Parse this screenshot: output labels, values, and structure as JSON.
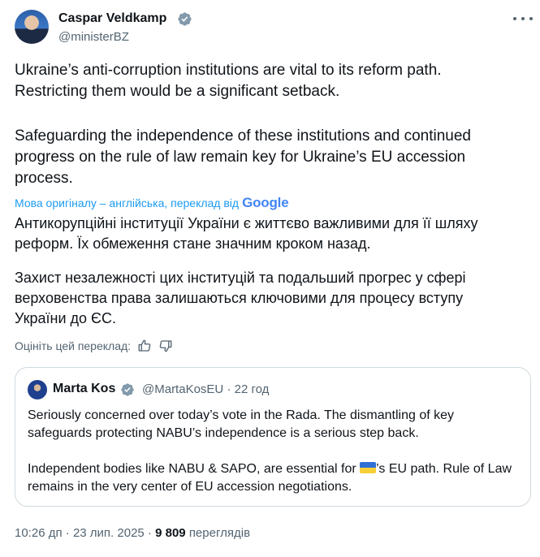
{
  "tweet": {
    "author_name": "Caspar Veldkamp",
    "handle": "@ministerBZ",
    "paragraph1": "Ukraine’s anti-corruption institutions are vital to its reform path.\nRestricting them would be a significant setback.",
    "paragraph2": "Safeguarding the independence of these institutions and continued\nprogress on the rule of law remain key for Ukraine’s EU accession\nprocess.",
    "translation_note": "Мова оригіналу – англійська, переклад від",
    "translation_provider": "Google",
    "translated_paragraph1": "Антикорупційні інституції України є життєво важливими для її шляху\nреформ. Їх обмеження стане значним кроком назад.",
    "translated_paragraph2": "Захист незалежності цих інституцій та подальший прогрес у сфері\nверховенства права залишаються ключовими для процесу вступу\nУкраїни до ЄС.",
    "rate_translation_label": "Оцініть цей переклад:",
    "time": "10:26 дп",
    "date": "23 лип. 2025",
    "views_count": "9 809",
    "views_label": "переглядів"
  },
  "quote": {
    "author_name": "Marta Kos",
    "handle": "@MartaKosEU",
    "age": "22 год",
    "text1": "Seriously concerned over today’s vote in the Rada. The dismantling of key safeguards protecting NABU’s independence is a serious step back.",
    "text2_before": "Independent bodies like NABU & SAPO, are essential for ",
    "text2_after": "’s EU path. Rule of Law remains in the very center of EU accession negotiations."
  },
  "icons": [
    "verified-badge-icon",
    "more-icon",
    "thumbs-up-icon",
    "thumbs-down-icon",
    "ukraine-flag-icon"
  ],
  "colors": {
    "link": "#1d9bf0",
    "secondary_text": "#536471",
    "border": "#cfd9de",
    "verified": "#829aab"
  }
}
